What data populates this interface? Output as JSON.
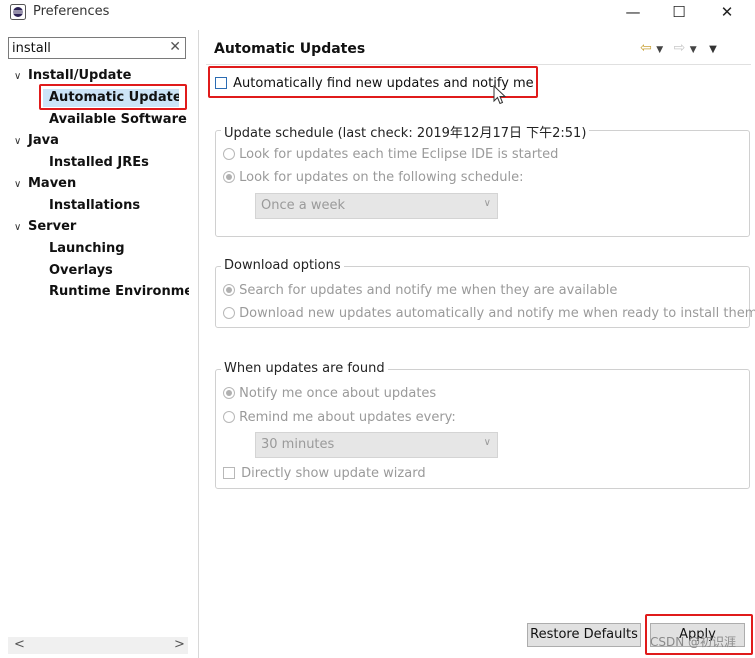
{
  "window": {
    "title": "Preferences",
    "minimize": "—",
    "maximize": "☐",
    "close": "✕"
  },
  "filter": {
    "value": "install",
    "clear": "✕"
  },
  "tree": {
    "groups": [
      {
        "label": "Install/Update",
        "children": [
          "Automatic Updates",
          "Available Software Si"
        ]
      },
      {
        "label": "Java",
        "children": [
          "Installed JREs"
        ]
      },
      {
        "label": "Maven",
        "children": [
          "Installations"
        ]
      },
      {
        "label": "Server",
        "children": [
          "Launching",
          "Overlays",
          "Runtime Environmen"
        ]
      }
    ],
    "selected": "Automatic Updates"
  },
  "scrollbar": {
    "left": "<",
    "right": ">"
  },
  "page": {
    "title": "Automatic Updates",
    "auto_find_label": "Automatically find new updates and notify me",
    "schedule": {
      "title": "Update schedule (last check: 2019年12月17日 下午2:51)",
      "opt_startup": "Look for updates each time Eclipse IDE is started",
      "opt_schedule": "Look for updates on the following schedule:",
      "combo_value": "Once a week"
    },
    "download": {
      "title": "Download options",
      "opt_search": "Search for updates and notify me when they are available",
      "opt_download": "Download new updates automatically and notify me when ready to install them"
    },
    "found": {
      "title": "When updates are found",
      "opt_notify_once": "Notify me once about updates",
      "opt_remind": "Remind me about updates every:",
      "combo_value": "30 minutes",
      "wizard_label": "Directly show update wizard"
    }
  },
  "buttons": {
    "restore_defaults": "Restore Defaults",
    "apply": "Apply"
  },
  "watermark": "CSDN @初识涯",
  "colors": {
    "highlight": "#e01b1b",
    "selection": "#cce4f7"
  }
}
